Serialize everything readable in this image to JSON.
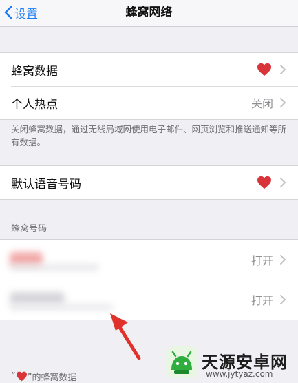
{
  "nav": {
    "back_label": "设置",
    "title": "蜂窝网络"
  },
  "group1": {
    "cellular_data_label": "蜂窝数据",
    "hotspot_label": "个人热点",
    "hotspot_value": "关闭"
  },
  "footnote": "关闭蜂窝数据，通过无线局域网使用电子邮件、网页浏览和推送通知等所有数据。",
  "group2": {
    "default_voice_label": "默认语音号码"
  },
  "section_header": "蜂窝号码",
  "group3": {
    "rows": [
      {
        "value": "打开"
      },
      {
        "value": "打开"
      }
    ]
  },
  "bottom_note": {
    "open_quote": "“",
    "close_quote": "”的蜂窝数据"
  },
  "watermark": {
    "title": "天源安卓网",
    "url": "www.jytyaz.com"
  },
  "colors": {
    "accent": "#1a7cf5",
    "heart": "#d9343a",
    "arrow": "#e0312b"
  }
}
